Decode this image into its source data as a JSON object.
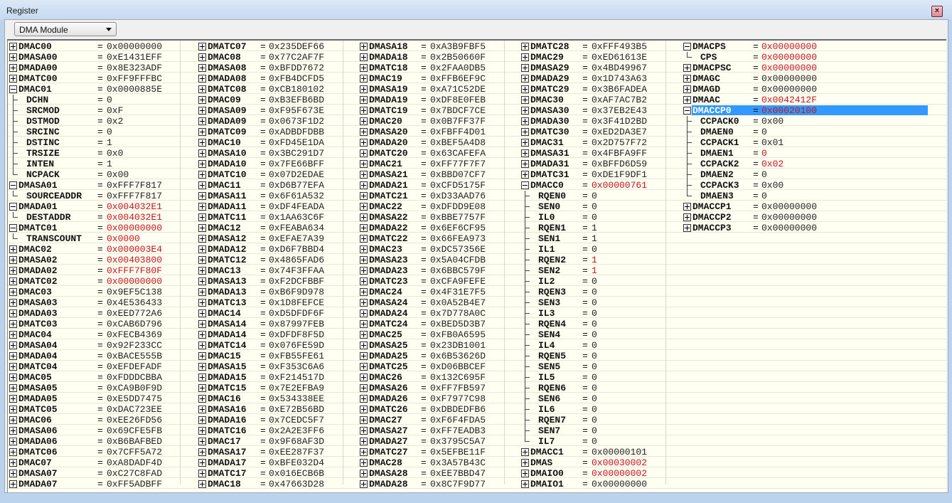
{
  "window": {
    "title": "Register",
    "close_icon": "close-icon"
  },
  "toolbar": {
    "module_select": "DMA Module"
  },
  "colors": {
    "changed_value": "#c8141e",
    "selection": "#3399ff",
    "grid_background": "#fffff2"
  },
  "columns": [
    [
      {
        "n": "DMAC00",
        "v": "0x00000000",
        "t": "+"
      },
      {
        "n": "DMASA00",
        "v": "0xE1431EFF",
        "t": "+"
      },
      {
        "n": "DMADA00",
        "v": "0x8E323ADF",
        "t": "+"
      },
      {
        "n": "DMATC00",
        "v": "0xFF9FFFBC",
        "t": "+"
      },
      {
        "n": "DMAC01",
        "v": "0x0000885E",
        "t": "-"
      },
      {
        "n": "DCHN",
        "v": "0",
        "t": "c"
      },
      {
        "n": "SRCMOD",
        "v": "0xF",
        "t": "c"
      },
      {
        "n": "DSTMOD",
        "v": "0x2",
        "t": "c"
      },
      {
        "n": "SRCINC",
        "v": "0",
        "t": "c"
      },
      {
        "n": "DSTINC",
        "v": "1",
        "t": "c"
      },
      {
        "n": "TRSIZE",
        "v": "0x0",
        "t": "c"
      },
      {
        "n": "INTEN",
        "v": "1",
        "t": "c"
      },
      {
        "n": "NCPACK",
        "v": "0x00",
        "t": "l"
      },
      {
        "n": "DMASA01",
        "v": "0xFFF7F817",
        "t": "-"
      },
      {
        "n": "SOURCEADDR",
        "v": "0xFFF7F817",
        "t": "l"
      },
      {
        "n": "DMADA01",
        "v": "0x004032E1",
        "t": "-",
        "r": true
      },
      {
        "n": "DESTADDR",
        "v": "0x004032E1",
        "t": "l",
        "r": true
      },
      {
        "n": "DMATC01",
        "v": "0x00000000",
        "t": "-",
        "r": true
      },
      {
        "n": "TRANSCOUNT",
        "v": "0x0000",
        "t": "l",
        "r": true
      },
      {
        "n": "DMAC02",
        "v": "0x000003E4",
        "t": "+",
        "r": true
      },
      {
        "n": "DMASA02",
        "v": "0x00403800",
        "t": "+",
        "r": true
      },
      {
        "n": "DMADA02",
        "v": "0xFFF7F80F",
        "t": "+",
        "r": true
      },
      {
        "n": "DMATC02",
        "v": "0x00000000",
        "t": "+",
        "r": true
      },
      {
        "n": "DMAC03",
        "v": "0x9EF5C138",
        "t": "+"
      },
      {
        "n": "DMASA03",
        "v": "0x4E536433",
        "t": "+"
      },
      {
        "n": "DMADA03",
        "v": "0xEED772A6",
        "t": "+"
      },
      {
        "n": "DMATC03",
        "v": "0xCAB6D796",
        "t": "+"
      },
      {
        "n": "DMAC04",
        "v": "0xFECB4369",
        "t": "+"
      },
      {
        "n": "DMASA04",
        "v": "0x92F233CC",
        "t": "+"
      },
      {
        "n": "DMADA04",
        "v": "0xBACE555B",
        "t": "+"
      },
      {
        "n": "DMATC04",
        "v": "0xEFDEFADF",
        "t": "+"
      },
      {
        "n": "DMAC05",
        "v": "0xFDDDCBBA",
        "t": "+"
      },
      {
        "n": "DMASA05",
        "v": "0xCA9B0F9D",
        "t": "+"
      },
      {
        "n": "DMADA05",
        "v": "0xE5DD7475",
        "t": "+"
      },
      {
        "n": "DMATC05",
        "v": "0xDAC723EE",
        "t": "+"
      },
      {
        "n": "DMAC06",
        "v": "0xEE26FD56",
        "t": "+"
      },
      {
        "n": "DMASA06",
        "v": "0x69CFE5FB",
        "t": "+"
      },
      {
        "n": "DMADA06",
        "v": "0xB6BAFBED",
        "t": "+"
      },
      {
        "n": "DMATC06",
        "v": "0x7CFF5A72",
        "t": "+"
      },
      {
        "n": "DMAC07",
        "v": "0xA8DADF4D",
        "t": "+"
      },
      {
        "n": "DMASA07",
        "v": "0xC27C8FAD",
        "t": "+"
      },
      {
        "n": "DMADA07",
        "v": "0xFF5ADBFF",
        "t": "+"
      }
    ],
    [
      {
        "n": "DMATC07",
        "v": "0x235DEF66",
        "t": "+"
      },
      {
        "n": "DMAC08",
        "v": "0x77C2AF7F",
        "t": "+"
      },
      {
        "n": "DMASA08",
        "v": "0xBFDD7672",
        "t": "+"
      },
      {
        "n": "DMADA08",
        "v": "0xFB4DCFD5",
        "t": "+"
      },
      {
        "n": "DMATC08",
        "v": "0xCB180102",
        "t": "+"
      },
      {
        "n": "DMAC09",
        "v": "0xB3EFB6BD",
        "t": "+"
      },
      {
        "n": "DMASA09",
        "v": "0xF95F673E",
        "t": "+"
      },
      {
        "n": "DMADA09",
        "v": "0x0673F1D2",
        "t": "+"
      },
      {
        "n": "DMATC09",
        "v": "0xADBDFDBB",
        "t": "+"
      },
      {
        "n": "DMAC10",
        "v": "0xFD45E1DA",
        "t": "+"
      },
      {
        "n": "DMASA10",
        "v": "0x3BC291D7",
        "t": "+"
      },
      {
        "n": "DMADA10",
        "v": "0x7FE66BFF",
        "t": "+"
      },
      {
        "n": "DMATC10",
        "v": "0x07D2EDAE",
        "t": "+"
      },
      {
        "n": "DMAC11",
        "v": "0xD6B77EFA",
        "t": "+"
      },
      {
        "n": "DMASA11",
        "v": "0x6F61A532",
        "t": "+"
      },
      {
        "n": "DMADA11",
        "v": "0xDF4FEADA",
        "t": "+"
      },
      {
        "n": "DMATC11",
        "v": "0x1AA63C6F",
        "t": "+"
      },
      {
        "n": "DMAC12",
        "v": "0xFEABA634",
        "t": "+"
      },
      {
        "n": "DMASA12",
        "v": "0xEFAE7A39",
        "t": "+"
      },
      {
        "n": "DMADA12",
        "v": "0xD6F7BBD4",
        "t": "+"
      },
      {
        "n": "DMATC12",
        "v": "0x4865FAD6",
        "t": "+"
      },
      {
        "n": "DMAC13",
        "v": "0x74F3FFAA",
        "t": "+"
      },
      {
        "n": "DMASA13",
        "v": "0xF2DCFBBF",
        "t": "+"
      },
      {
        "n": "DMADA13",
        "v": "0xB6F9D978",
        "t": "+"
      },
      {
        "n": "DMATC13",
        "v": "0x1D8FEFCE",
        "t": "+"
      },
      {
        "n": "DMAC14",
        "v": "0xD5DFDF6F",
        "t": "+"
      },
      {
        "n": "DMASA14",
        "v": "0x87997FEB",
        "t": "+"
      },
      {
        "n": "DMADA14",
        "v": "0xDFDF8F5D",
        "t": "+"
      },
      {
        "n": "DMATC14",
        "v": "0x076FE59D",
        "t": "+"
      },
      {
        "n": "DMAC15",
        "v": "0xFB55FE61",
        "t": "+"
      },
      {
        "n": "DMASA15",
        "v": "0xF353C6A6",
        "t": "+"
      },
      {
        "n": "DMADA15",
        "v": "0xF214517D",
        "t": "+"
      },
      {
        "n": "DMATC15",
        "v": "0x7E2EFBA9",
        "t": "+"
      },
      {
        "n": "DMAC16",
        "v": "0x534338EE",
        "t": "+"
      },
      {
        "n": "DMASA16",
        "v": "0xE72B56BD",
        "t": "+"
      },
      {
        "n": "DMADA16",
        "v": "0x7CEDC5F7",
        "t": "+"
      },
      {
        "n": "DMATC16",
        "v": "0x2A2E3FF6",
        "t": "+"
      },
      {
        "n": "DMAC17",
        "v": "0x9F68AF3D",
        "t": "+"
      },
      {
        "n": "DMASA17",
        "v": "0xEE287F37",
        "t": "+"
      },
      {
        "n": "DMADA17",
        "v": "0xBFE032D4",
        "t": "+"
      },
      {
        "n": "DMATC17",
        "v": "0x016ECB6B",
        "t": "+"
      },
      {
        "n": "DMAC18",
        "v": "0x47663D28",
        "t": "+"
      }
    ],
    [
      {
        "n": "DMASA18",
        "v": "0xA3B9FBF5",
        "t": "+"
      },
      {
        "n": "DMADA18",
        "v": "0x2B50660F",
        "t": "+"
      },
      {
        "n": "DMATC18",
        "v": "0x2FAA0DB5",
        "t": "+"
      },
      {
        "n": "DMAC19",
        "v": "0xFFB6EF9C",
        "t": "+"
      },
      {
        "n": "DMASA19",
        "v": "0xA71C52DE",
        "t": "+"
      },
      {
        "n": "DMADA19",
        "v": "0xDF8E0FEB",
        "t": "+"
      },
      {
        "n": "DMATC19",
        "v": "0x7BDCF7CE",
        "t": "+"
      },
      {
        "n": "DMAC20",
        "v": "0x0B7FF37F",
        "t": "+"
      },
      {
        "n": "DMASA20",
        "v": "0xFBFF4D01",
        "t": "+"
      },
      {
        "n": "DMADA20",
        "v": "0xBEF5A4D8",
        "t": "+"
      },
      {
        "n": "DMATC20",
        "v": "0x63CAFEFA",
        "t": "+"
      },
      {
        "n": "DMAC21",
        "v": "0xFF77F7F7",
        "t": "+"
      },
      {
        "n": "DMASA21",
        "v": "0xBBD07CF7",
        "t": "+"
      },
      {
        "n": "DMADA21",
        "v": "0xCFD5175F",
        "t": "+"
      },
      {
        "n": "DMATC21",
        "v": "0xD33AAD76",
        "t": "+"
      },
      {
        "n": "DMAC22",
        "v": "0xDFDD9E08",
        "t": "+"
      },
      {
        "n": "DMASA22",
        "v": "0xBBE7757F",
        "t": "+"
      },
      {
        "n": "DMADA22",
        "v": "0x6EF6CF95",
        "t": "+"
      },
      {
        "n": "DMATC22",
        "v": "0x66FEA973",
        "t": "+"
      },
      {
        "n": "DMAC23",
        "v": "0xDC57356E",
        "t": "+"
      },
      {
        "n": "DMASA23",
        "v": "0x5A04CFDB",
        "t": "+"
      },
      {
        "n": "DMADA23",
        "v": "0x6BBC579F",
        "t": "+"
      },
      {
        "n": "DMATC23",
        "v": "0xCFA9FEFE",
        "t": "+"
      },
      {
        "n": "DMAC24",
        "v": "0x4F31E7F5",
        "t": "+"
      },
      {
        "n": "DMASA24",
        "v": "0x0A52B4E7",
        "t": "+"
      },
      {
        "n": "DMADA24",
        "v": "0x7D778A0C",
        "t": "+"
      },
      {
        "n": "DMATC24",
        "v": "0xBED5D3B7",
        "t": "+"
      },
      {
        "n": "DMAC25",
        "v": "0xFB0A6595",
        "t": "+"
      },
      {
        "n": "DMASA25",
        "v": "0x23DB1001",
        "t": "+"
      },
      {
        "n": "DMADA25",
        "v": "0x6B53626D",
        "t": "+"
      },
      {
        "n": "DMATC25",
        "v": "0xD06BBCEF",
        "t": "+"
      },
      {
        "n": "DMAC26",
        "v": "0x132C695F",
        "t": "+"
      },
      {
        "n": "DMASA26",
        "v": "0xFF7FB597",
        "t": "+"
      },
      {
        "n": "DMADA26",
        "v": "0xF7977C98",
        "t": "+"
      },
      {
        "n": "DMATC26",
        "v": "0xDBDEDFB6",
        "t": "+"
      },
      {
        "n": "DMAC27",
        "v": "0xF6F4FDA5",
        "t": "+"
      },
      {
        "n": "DMASA27",
        "v": "0xFF7EADB3",
        "t": "+"
      },
      {
        "n": "DMADA27",
        "v": "0x3795C5A7",
        "t": "+"
      },
      {
        "n": "DMATC27",
        "v": "0x5EFBE11F",
        "t": "+"
      },
      {
        "n": "DMAC28",
        "v": "0x3A57B43C",
        "t": "+"
      },
      {
        "n": "DMASA28",
        "v": "0xEE7BBD47",
        "t": "+"
      },
      {
        "n": "DMADA28",
        "v": "0x8C7F9D77",
        "t": "+"
      }
    ],
    [
      {
        "n": "DMATC28",
        "v": "0xFFF493B5",
        "t": "+"
      },
      {
        "n": "DMAC29",
        "v": "0xED61613E",
        "t": "+"
      },
      {
        "n": "DMASA29",
        "v": "0x4BD49967",
        "t": "+"
      },
      {
        "n": "DMADA29",
        "v": "0x1D743A63",
        "t": "+"
      },
      {
        "n": "DMATC29",
        "v": "0x3B6FADEA",
        "t": "+"
      },
      {
        "n": "DMAC30",
        "v": "0xAF7AC7B2",
        "t": "+"
      },
      {
        "n": "DMASA30",
        "v": "0x37EB2E43",
        "t": "+"
      },
      {
        "n": "DMADA30",
        "v": "0x3F41D2BD",
        "t": "+"
      },
      {
        "n": "DMATC30",
        "v": "0xED2DA3E7",
        "t": "+"
      },
      {
        "n": "DMAC31",
        "v": "0x2D757F72",
        "t": "+"
      },
      {
        "n": "DMASA31",
        "v": "0x4FBFA9FF",
        "t": "+"
      },
      {
        "n": "DMADA31",
        "v": "0xBFFD6D59",
        "t": "+"
      },
      {
        "n": "DMATC31",
        "v": "0xDE1F9DF1",
        "t": "+"
      },
      {
        "n": "DMACC0",
        "v": "0x00000761",
        "t": "-",
        "r": true
      },
      {
        "n": "RQEN0",
        "v": "0",
        "t": "c"
      },
      {
        "n": "SEN0",
        "v": "0",
        "t": "c"
      },
      {
        "n": "IL0",
        "v": "0",
        "t": "c"
      },
      {
        "n": "RQEN1",
        "v": "1",
        "t": "c"
      },
      {
        "n": "SEN1",
        "v": "1",
        "t": "c"
      },
      {
        "n": "IL1",
        "v": "0",
        "t": "c"
      },
      {
        "n": "RQEN2",
        "v": "1",
        "t": "c",
        "r": true
      },
      {
        "n": "SEN2",
        "v": "1",
        "t": "c",
        "r": true
      },
      {
        "n": "IL2",
        "v": "0",
        "t": "c"
      },
      {
        "n": "RQEN3",
        "v": "0",
        "t": "c"
      },
      {
        "n": "SEN3",
        "v": "0",
        "t": "c"
      },
      {
        "n": "IL3",
        "v": "0",
        "t": "c"
      },
      {
        "n": "RQEN4",
        "v": "0",
        "t": "c"
      },
      {
        "n": "SEN4",
        "v": "0",
        "t": "c"
      },
      {
        "n": "IL4",
        "v": "0",
        "t": "c"
      },
      {
        "n": "RQEN5",
        "v": "0",
        "t": "c"
      },
      {
        "n": "SEN5",
        "v": "0",
        "t": "c"
      },
      {
        "n": "IL5",
        "v": "0",
        "t": "c"
      },
      {
        "n": "RQEN6",
        "v": "0",
        "t": "c"
      },
      {
        "n": "SEN6",
        "v": "0",
        "t": "c"
      },
      {
        "n": "IL6",
        "v": "0",
        "t": "c"
      },
      {
        "n": "RQEN7",
        "v": "0",
        "t": "c"
      },
      {
        "n": "SEN7",
        "v": "0",
        "t": "c"
      },
      {
        "n": "IL7",
        "v": "0",
        "t": "l"
      },
      {
        "n": "DMACC1",
        "v": "0x00000101",
        "t": "+"
      },
      {
        "n": "DMAS",
        "v": "0x00030002",
        "t": "+",
        "r": true
      },
      {
        "n": "DMAIO0",
        "v": "0x00000002",
        "t": "+",
        "r": true
      },
      {
        "n": "DMAIO1",
        "v": "0x00000000",
        "t": "+"
      }
    ],
    [
      {
        "n": "DMACPS",
        "v": "0x00000000",
        "t": "-",
        "r": true
      },
      {
        "n": "CPS",
        "v": "0x00000000",
        "t": "l",
        "r": true
      },
      {
        "n": "DMACPSC",
        "v": "0x00000000",
        "t": "+",
        "r": true
      },
      {
        "n": "DMAGC",
        "v": "0x00000000",
        "t": "+"
      },
      {
        "n": "DMAGD",
        "v": "0x00000000",
        "t": "+"
      },
      {
        "n": "DMAAC",
        "v": "0x0042412F",
        "t": "+",
        "r": true
      },
      {
        "n": "DMACCP0",
        "v": "0x00020100",
        "t": "-",
        "r": true,
        "selected": true
      },
      {
        "n": "CCPACK0",
        "v": "0x00",
        "t": "c"
      },
      {
        "n": "DMAEN0",
        "v": "0",
        "t": "c"
      },
      {
        "n": "CCPACK1",
        "v": "0x01",
        "t": "c"
      },
      {
        "n": "DMAEN1",
        "v": "0",
        "t": "c",
        "r": true
      },
      {
        "n": "CCPACK2",
        "v": "0x02",
        "t": "c",
        "r": true
      },
      {
        "n": "DMAEN2",
        "v": "0",
        "t": "c"
      },
      {
        "n": "CCPACK3",
        "v": "0x00",
        "t": "c"
      },
      {
        "n": "DMAEN3",
        "v": "0",
        "t": "l"
      },
      {
        "n": "DMACCP1",
        "v": "0x00000000",
        "t": "+"
      },
      {
        "n": "DMACCP2",
        "v": "0x00000000",
        "t": "+"
      },
      {
        "n": "DMACCP3",
        "v": "0x00000000",
        "t": "+"
      }
    ]
  ]
}
